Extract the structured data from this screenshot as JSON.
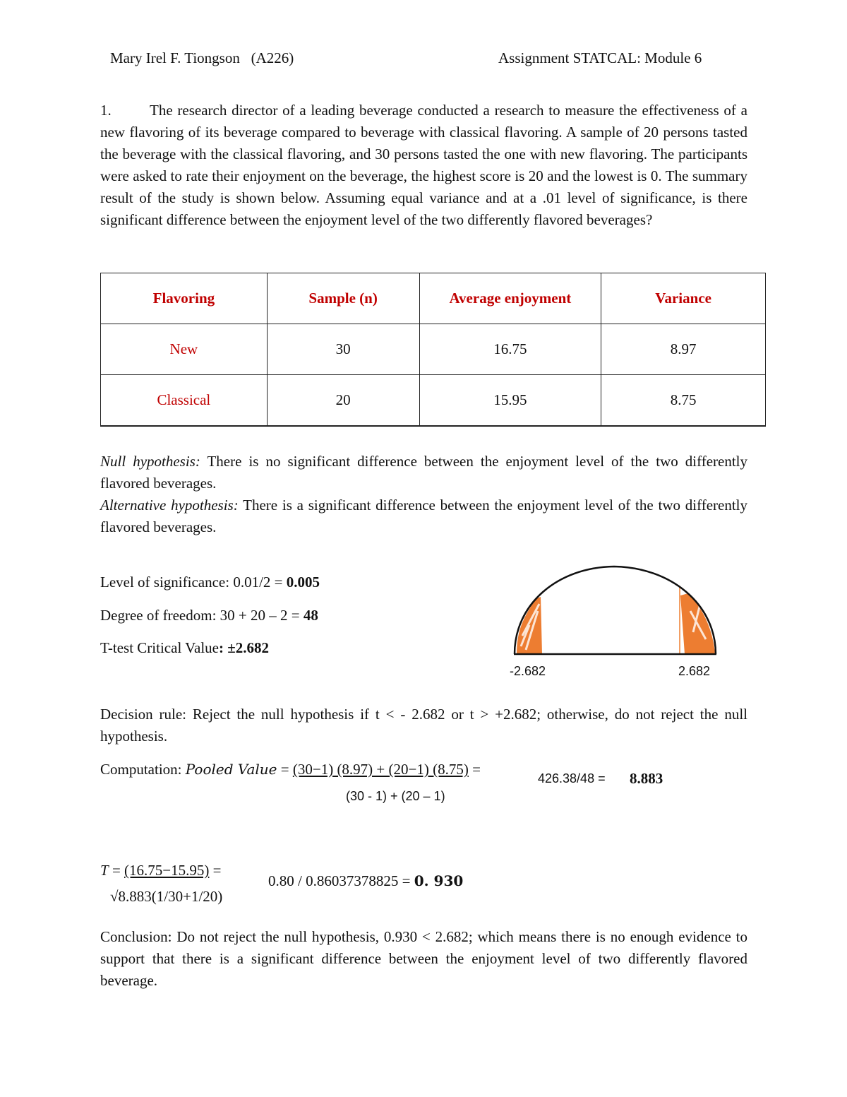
{
  "header": {
    "author": "Mary Irel F. Tiongson   (A226)",
    "assignment": "Assignment STATCAL: Module 6"
  },
  "question": {
    "number": "1.",
    "text": "The research director of a leading beverage conducted a research to measure the effectiveness of a new flavoring of its beverage compared to beverage with classical flavoring. A sample of 20 persons tasted the beverage with the classical flavoring, and 30 persons tasted the one with new flavoring. The participants were asked to rate their enjoyment on the beverage, the highest score is 20 and the lowest is 0.  The summary result of the study is shown below. Assuming equal variance and at a .01 level of significance, is there significant difference between the enjoyment level of the two differently flavored beverages?"
  },
  "table": {
    "headers": [
      "Flavoring",
      "Sample (n)",
      "Average enjoyment",
      "Variance"
    ],
    "rows": [
      {
        "flavoring": "New",
        "sample": "30",
        "average": "16.75",
        "variance": "8.97"
      },
      {
        "flavoring": "Classical",
        "sample": "20",
        "average": "15.95",
        "variance": "8.75"
      }
    ],
    "header_color": "#c00000"
  },
  "hypotheses": {
    "null_label": "Null hypothesis:",
    "null_text": " There is no significant difference between the enjoyment level of the two differently flavored beverages.",
    "alt_label": "Alternative hypothesis:",
    "alt_text": " There is a significant difference between the enjoyment level of the two differently flavored beverages."
  },
  "parameters": {
    "significance_label": "Level of significance: 0.01/2 = ",
    "significance_value": "0.005",
    "df_label": "Degree of freedom: 30 + 20 – 2 = ",
    "df_value": "48",
    "critical_label": "T-test Critical Value",
    "critical_colon": ": ",
    "critical_value": "±2.682"
  },
  "curve": {
    "left_label": "-2.682",
    "right_label": "2.682",
    "shade_color": "#ed7d31"
  },
  "decision": {
    "text": "Decision rule: Reject the null hypothesis if t < - 2.682 or t > +2.682; otherwise, do not reject the null hypothesis."
  },
  "computation": {
    "label": "Computation: ",
    "pooled_label": "Pooled Value",
    "eq": " = ",
    "numerator": "(30−1) (8.97) + (20−1) (8.75)",
    "trailing_eq": " =",
    "denominator": "(30 - 1) + (20 – 1)",
    "division": "426.38/48 =",
    "result": "8.883"
  },
  "t_stat": {
    "label": "T",
    "eq": " = ",
    "numerator": "(16.75−15.95)",
    "trailing_eq": " =",
    "denominator": "√8.883(1/30+1/20)",
    "division": "0.80 / 0.86037378825 = ",
    "result": "0. 930"
  },
  "conclusion": {
    "text": "Conclusion: Do not reject the null hypothesis, 0.930 < 2.682; which means there is no enough evidence to support that there is a significant difference between the enjoyment level of two differently flavored beverage."
  }
}
